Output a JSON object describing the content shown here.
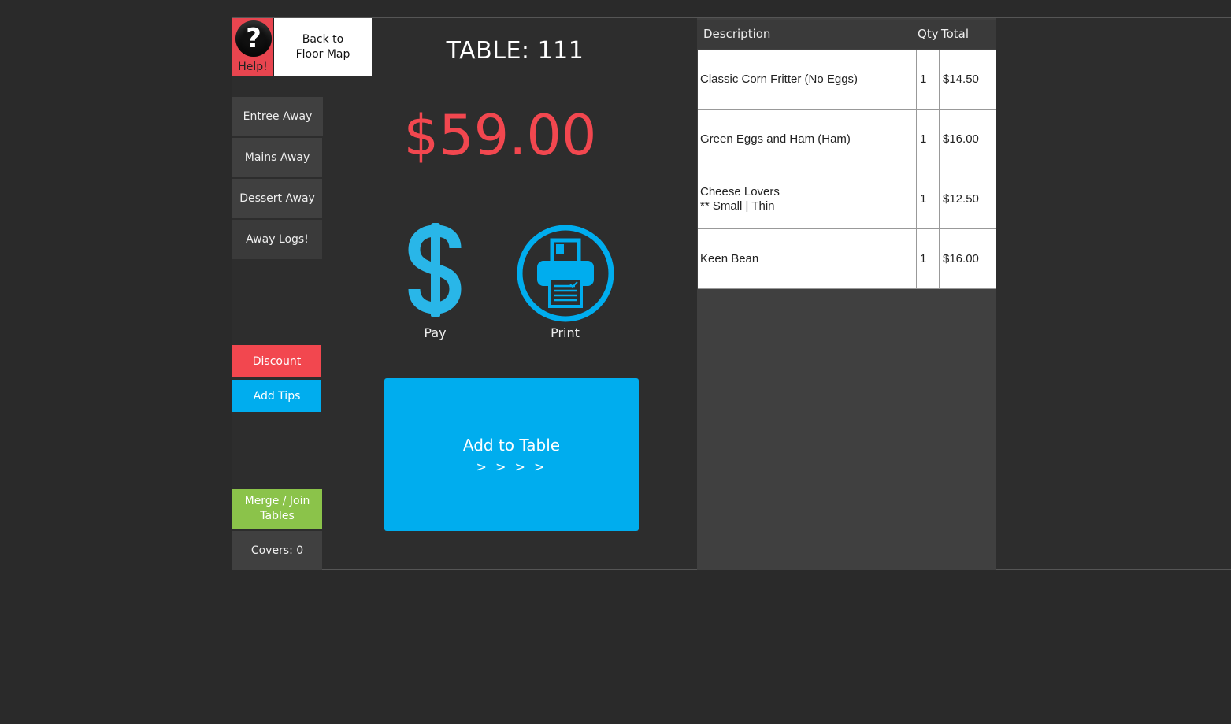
{
  "header": {
    "help_label": "Help!",
    "help_glyph": "?",
    "back_line1": "Back to",
    "back_line2": "Floor Map"
  },
  "sidebar": {
    "entree_away": "Entree Away",
    "mains_away": "Mains Away",
    "dessert_away": "Dessert Away",
    "away_logs": "Away Logs!",
    "discount": "Discount",
    "add_tips": "Add Tips",
    "merge_line1": "Merge / Join",
    "merge_line2": "Tables",
    "covers": "Covers: 0"
  },
  "main": {
    "table_title": "TABLE: 111",
    "total": "$59.00",
    "pay_label": "Pay",
    "print_label": "Print",
    "add_label": "Add to Table",
    "add_arrows": "> > > >"
  },
  "order": {
    "headers": {
      "description": "Description",
      "qty": "Qty",
      "total": "Total"
    },
    "items": [
      {
        "line1": "Classic Corn Fritter (No Eggs)",
        "line2": "",
        "qty": "1",
        "total": "$14.50"
      },
      {
        "line1": "Green Eggs and Ham  (Ham)",
        "line2": "",
        "qty": "1",
        "total": "$16.00"
      },
      {
        "line1": "Cheese Lovers",
        "line2": "** Small  | Thin",
        "qty": "1",
        "total": "$12.50"
      },
      {
        "line1": "Keen Bean",
        "line2": "",
        "qty": "1",
        "total": "$16.00"
      }
    ]
  },
  "colors": {
    "accent_blue": "#00adee",
    "accent_red": "#f2474f",
    "accent_green": "#8bc34a",
    "icon_blue": "#29b6e8"
  },
  "icons": {
    "pay": "dollar-sign-icon",
    "print": "printer-icon",
    "help": "question-mark-icon"
  }
}
